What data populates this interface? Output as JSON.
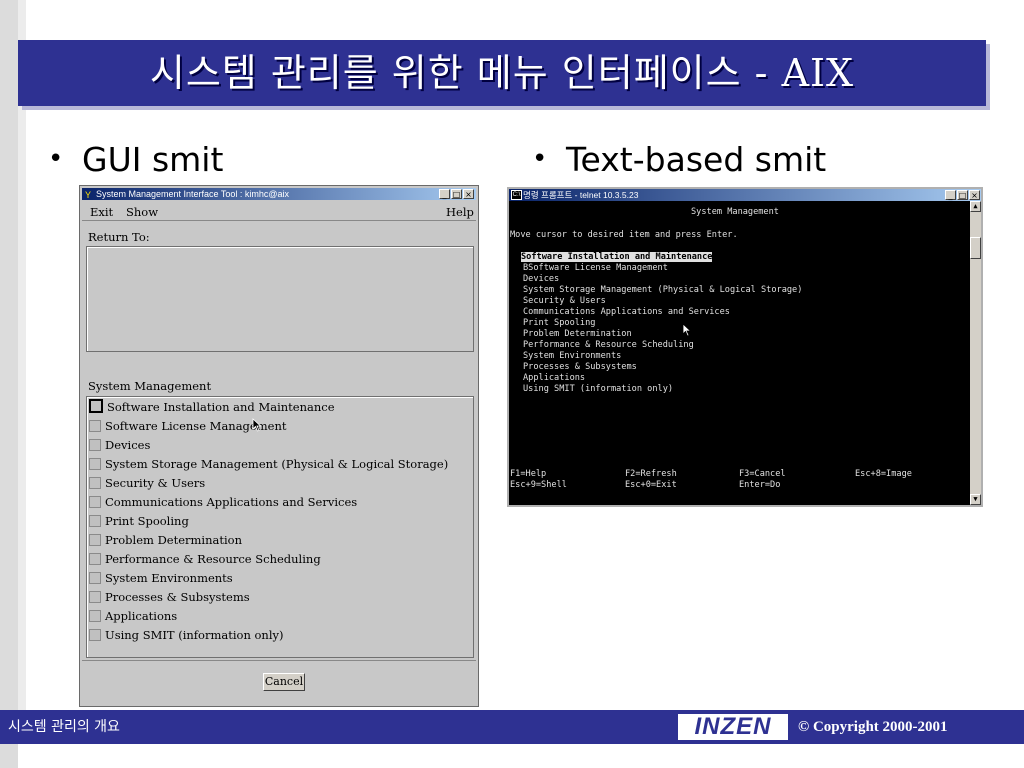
{
  "slide": {
    "title": "시스템 관리를 위한 메뉴 인터페이스 - AIX",
    "bullet_gui": "GUI smit",
    "bullet_text": "Text-based smit",
    "footer_left": "시스템 관리의 개요",
    "footer_logo": "INZEN",
    "footer_copyright": "© Copyright 2000-2001",
    "colors": {
      "title_bar": "#2e3192",
      "footer_bar": "#2e3192"
    }
  },
  "gui_window": {
    "title": "System Management Interface Tool : kimhc@aix",
    "menu": {
      "exit": "Exit",
      "show": "Show",
      "help": "Help"
    },
    "return_to_label": "Return To:",
    "section_label": "System Management",
    "items": [
      "Software Installation and Maintenance",
      "Software License Management",
      "Devices",
      "System Storage Management (Physical & Logical Storage)",
      "Security & Users",
      "Communications Applications and Services",
      "Print Spooling",
      "Problem Determination",
      "Performance & Resource Scheduling",
      "System Environments",
      "Processes & Subsystems",
      "Applications",
      "Using SMIT (information only)"
    ],
    "cancel_label": "Cancel"
  },
  "telnet_window": {
    "title": "명령 프롬프트 - telnet 10.3.5.23",
    "header": "System Management",
    "instruction": "Move cursor to desired item and press Enter.",
    "items": [
      "Software Installation and Maintenance",
      "BSoftware License Management",
      "Devices",
      "System Storage Management (Physical & Logical Storage)",
      "Security & Users",
      "Communications Applications and Services",
      "Print Spooling",
      "Problem Determination",
      "Performance & Resource Scheduling",
      "System Environments",
      "Processes & Subsystems",
      "Applications",
      "Using SMIT (information only)"
    ],
    "keys_row1": [
      "F1=Help",
      "F2=Refresh",
      "F3=Cancel",
      "Esc+8=Image"
    ],
    "keys_row2": [
      "Esc+9=Shell",
      "Esc+0=Exit",
      "Enter=Do"
    ]
  }
}
